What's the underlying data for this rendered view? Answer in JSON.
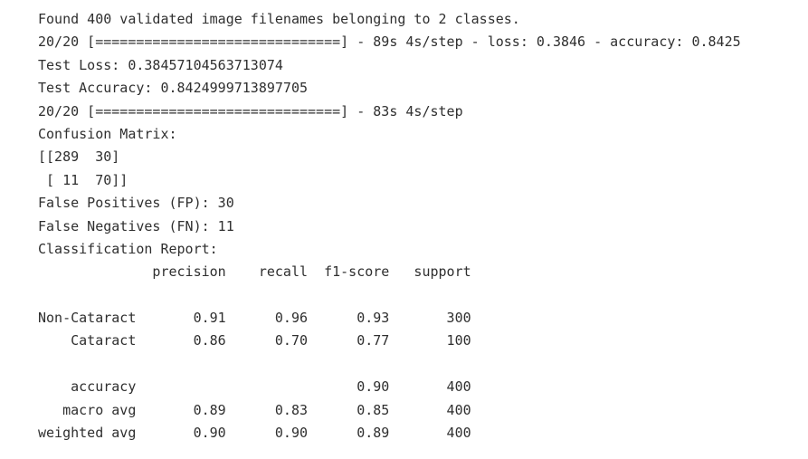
{
  "output": {
    "found_images": "Found 400 validated image filenames belonging to 2 classes.",
    "eval_progress": "20/20 [==============================] - 89s 4s/step - loss: 0.3846 - accuracy: 0.8425",
    "test_loss": "Test Loss: 0.38457104563713074",
    "test_accuracy": "Test Accuracy: 0.8424999713897705",
    "predict_progress": "20/20 [==============================] - 83s 4s/step",
    "confusion_header": "Confusion Matrix:",
    "confusion_row_1": "[[289  30]",
    "confusion_row_2": " [ 11  70]]",
    "false_positives": "False Positives (FP): 30",
    "false_negatives": "False Negatives (FN): 11",
    "report_header": "Classification Report:",
    "report_columns": "              precision    recall  f1-score   support",
    "report_blank_1": "",
    "report_non_cataract": "Non-Cataract       0.91      0.96      0.93       300",
    "report_cataract": "    Cataract       0.86      0.70      0.77       100",
    "report_blank_2": "",
    "report_accuracy": "    accuracy                           0.90       400",
    "report_macro": "   macro avg       0.89      0.83      0.85       400",
    "report_weighted": "weighted avg       0.90      0.90      0.89       400"
  }
}
